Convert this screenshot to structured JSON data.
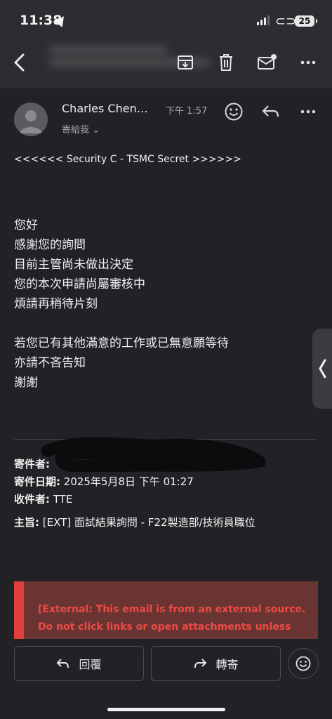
{
  "status_bar": {
    "time": "11:38",
    "battery": "25"
  },
  "email": {
    "sender": "Charles Chen…",
    "to_line": "寄給我",
    "sent_time": "下午 1:57",
    "classification": "<<<<<< Security C - TSMC Secret >>>>>>",
    "body": [
      "您好",
      "感謝您的詢問",
      "目前主管尚未做出決定",
      "您的本次申請尚屬審核中",
      "煩請再稍待片刻",
      "若您已有其他滿意的工作或已無意願等待",
      "亦請不吝告知",
      "謝謝"
    ],
    "forwarded": {
      "from_label": "寄件者:",
      "date_label": "寄件日期:",
      "date_value": "2025年5月8日 下午 01:27",
      "to_label": "收件者:",
      "to_value": "TTE",
      "subject_label": "主旨:",
      "subject_value": "[EXT] 面試結果詢問 - F22製造部/技術員職位"
    },
    "warning": [
      "[External: This email is from an external source.",
      "Do not click links or open attachments unless"
    ]
  },
  "actions": {
    "reply": "回覆",
    "forward": "轉寄"
  },
  "icons": [
    "back-icon",
    "archive-icon",
    "trash-icon",
    "mark-unread-icon",
    "more-icon",
    "emoji-icon",
    "reply-icon"
  ]
}
